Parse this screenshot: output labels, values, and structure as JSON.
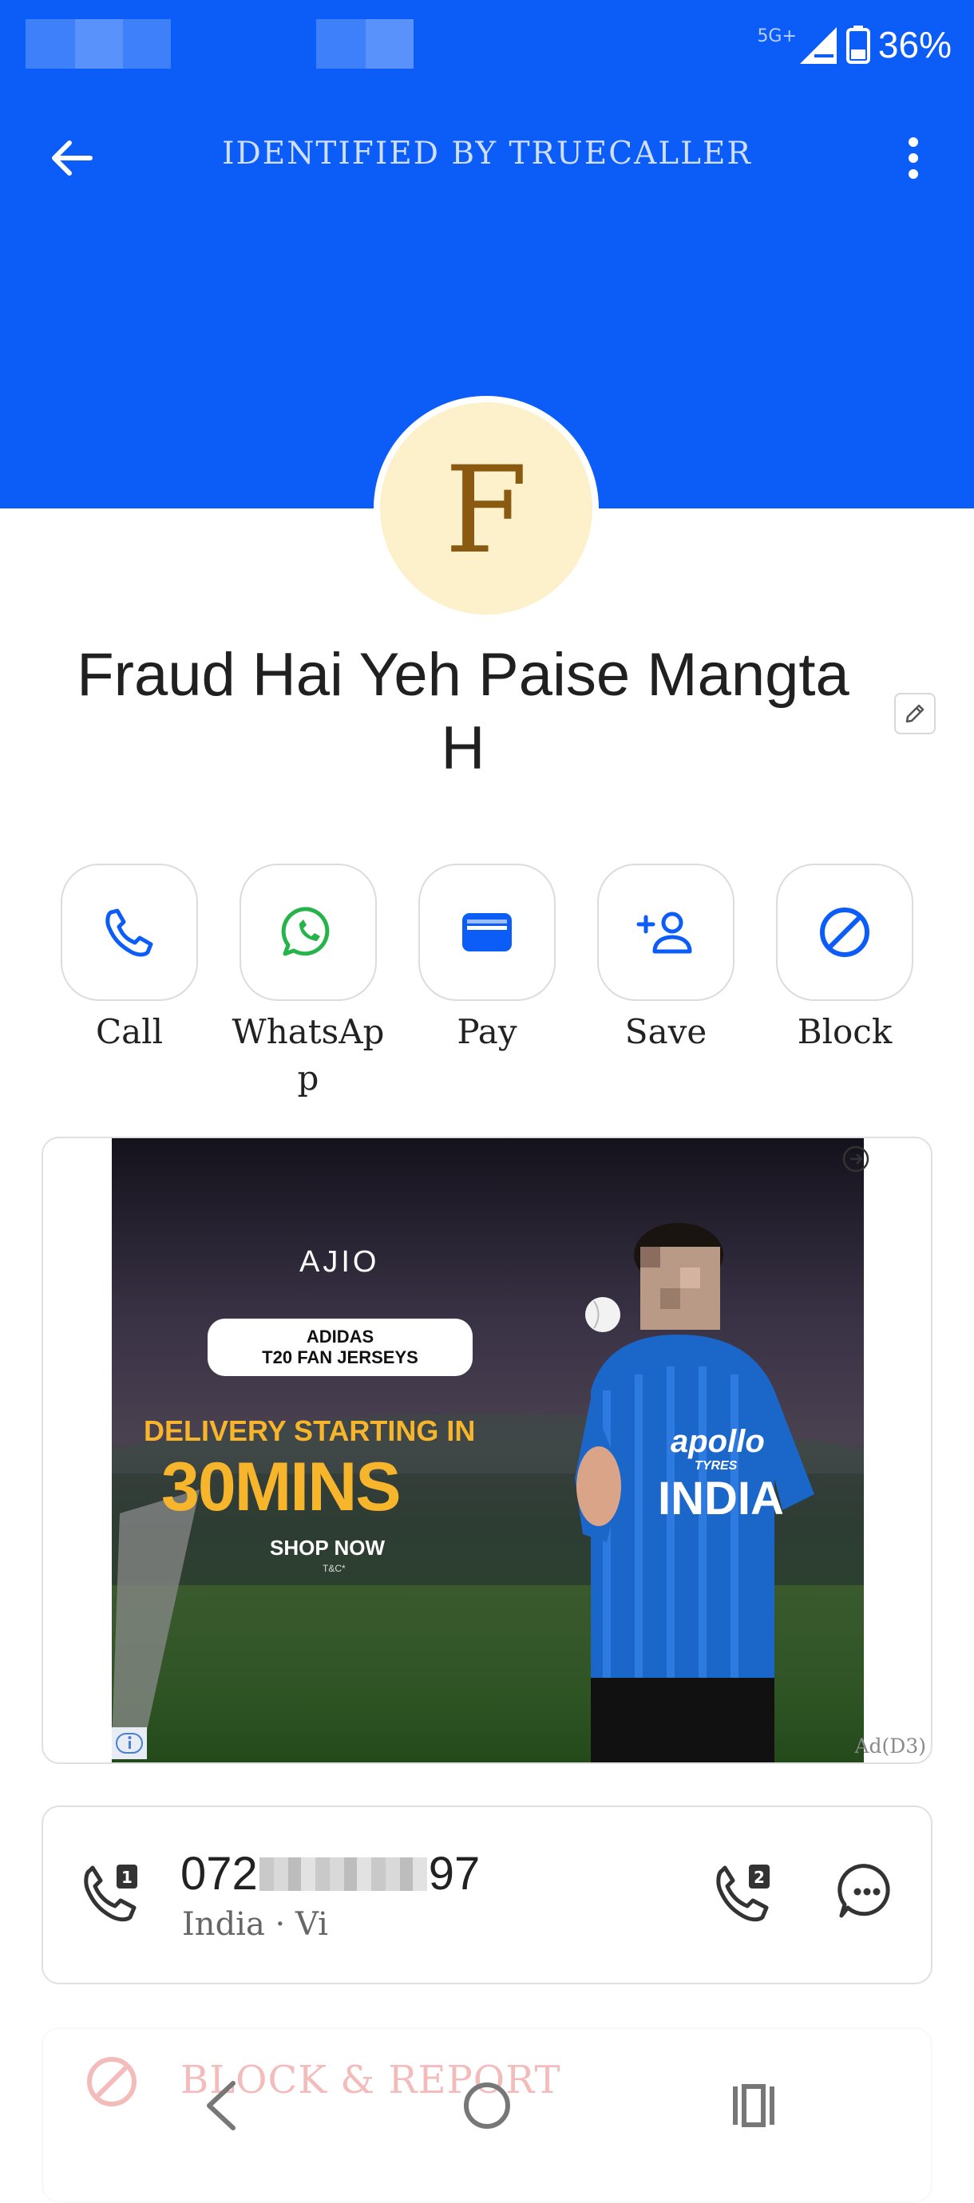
{
  "status_bar": {
    "network": "5G+",
    "battery": "36%",
    "icons": [
      "signal-icon",
      "battery-icon"
    ]
  },
  "header": {
    "title": "IDENTIFIED BY TRUECALLER",
    "back_icon": "arrow-left-icon",
    "menu_icon": "more-vertical-icon",
    "color": "#0c5cf8"
  },
  "contact": {
    "avatar_letter": "F",
    "name": "Fraud Hai Yeh Paise Mangta H",
    "edit_icon": "pencil-icon"
  },
  "actions": [
    {
      "label": "Call",
      "icon": "phone-icon"
    },
    {
      "label": "WhatsApp",
      "icon": "whatsapp-icon"
    },
    {
      "label": "Pay",
      "icon": "wallet-icon"
    },
    {
      "label": "Save",
      "icon": "add-person-icon"
    },
    {
      "label": "Block",
      "icon": "block-icon"
    }
  ],
  "ad": {
    "brand": "AJIO",
    "pill_line1": "ADIDAS",
    "pill_line2": "T20 FAN JERSEYS",
    "headline": "DELIVERY STARTING IN",
    "big_text": "30MINS",
    "cta": "SHOP NOW",
    "fine_print": "T&C*",
    "jersey_sponsor": "apollo",
    "jersey_sponsor_sub": "TYRES",
    "jersey_text": "INDIA",
    "label": "Ad(D3)"
  },
  "number": {
    "prefix": "072",
    "suffix": "97",
    "meta": "India · Vi"
  },
  "block_report": {
    "label": "BLOCK & REPORT",
    "color": "#e86a6a"
  },
  "accent_color": "#0c5cf8"
}
